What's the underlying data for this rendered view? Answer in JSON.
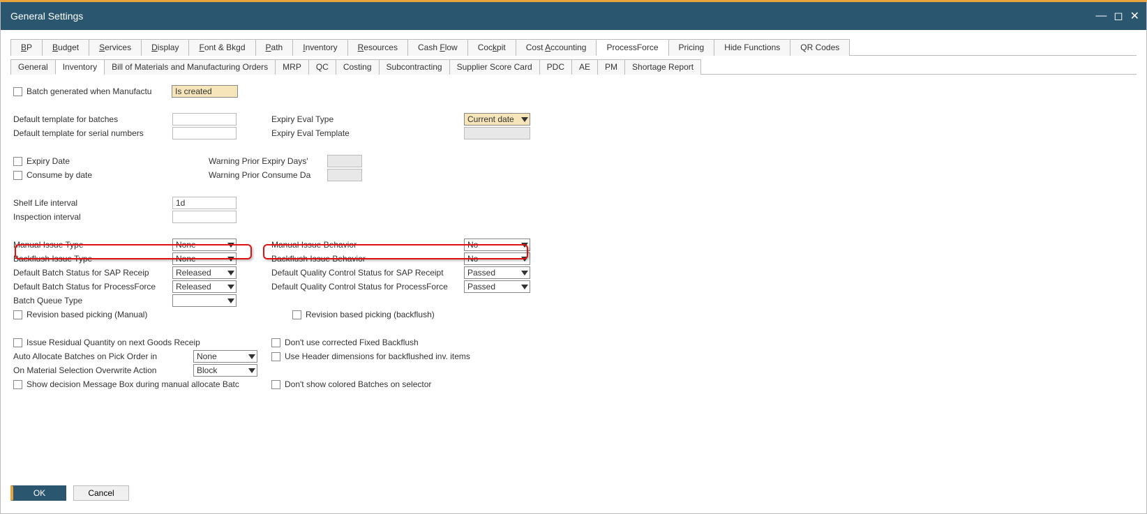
{
  "window": {
    "title": "General Settings"
  },
  "mainTabs": [
    {
      "label": "BP",
      "ul": "B",
      "rest": "P"
    },
    {
      "label": "Budget",
      "ul": "B",
      "rest": "udget"
    },
    {
      "label": "Services",
      "ul": "S",
      "rest": "ervices"
    },
    {
      "label": "Display",
      "ul": "D",
      "rest": "isplay"
    },
    {
      "label": "Font & Bkgd",
      "ul": "F",
      "rest": "ont & Bkgd"
    },
    {
      "label": "Path",
      "ul": "P",
      "rest": "ath"
    },
    {
      "label": "Inventory",
      "ul": "I",
      "rest": "nventory"
    },
    {
      "label": "Resources",
      "ul": "R",
      "rest": "esources"
    },
    {
      "label": "Cash Flow",
      "pre": "Cash ",
      "ul": "F",
      "rest": "low"
    },
    {
      "label": "Cockpit",
      "pre": "Coc",
      "ul": "k",
      "rest": "pit"
    },
    {
      "label": "Cost Accounting",
      "pre": "Cost ",
      "ul": "A",
      "rest": "ccounting"
    },
    {
      "label": "ProcessForce"
    },
    {
      "label": "Pricing"
    },
    {
      "label": "Hide Functions"
    },
    {
      "label": "QR Codes"
    }
  ],
  "subTabs": [
    "General",
    "Inventory",
    "Bill of Materials and Manufacturing Orders",
    "MRP",
    "QC",
    "Costing",
    "Subcontracting",
    "Supplier Score Card",
    "PDC",
    "AE",
    "PM",
    "Shortage Report"
  ],
  "labels": {
    "batchGenerated": "Batch generated when Manufactu",
    "isCreated": "Is created",
    "defaultTemplateBatches": "Default template for batches",
    "defaultTemplateSerial": "Default template for serial numbers",
    "expiryEvalType": "Expiry Eval Type",
    "expiryEvalTemplate": "Expiry Eval Template",
    "expiryDate": "Expiry Date",
    "consumeByDate": "Consume by date",
    "warningPriorExpiry": "Warning Prior Expiry Days'",
    "warningPriorConsume": "Warning Prior Consume Da",
    "shelfLifeInterval": "Shelf Life interval",
    "inspectionInterval": "Inspection interval",
    "manualIssueType": "Manual Issue Type",
    "manualIssueBehavior": "Manual Issue Behavior",
    "backflushIssueType": "Backflush Issue Type",
    "backflushIssueBehavior": "Backflush Issue Behavior",
    "defaultBatchSAP": "Default Batch Status for SAP Receip",
    "defaultQCSAP": "Default Quality Control Status for SAP Receipt",
    "defaultBatchPF": "Default Batch Status for ProcessForce",
    "defaultQCPF": "Default Quality Control Status for ProcessForce",
    "batchQueueType": "Batch Queue Type",
    "revisionManual": "Revision based picking (Manual)",
    "revisionBackflush": "Revision based picking (backflush)",
    "issueResidual": "Issue Residual Quantity on next Goods Receip",
    "autoAllocate": "Auto Allocate Batches on Pick Order in",
    "onMaterialSelection": "On Material Selection Overwrite Action",
    "showDecisionMsg": "Show decision Message Box during manual allocate Batc",
    "dontUseCorrected": "Don't use corrected Fixed Backflush",
    "useHeaderDim": "Use Header dimensions for backflushed inv. items",
    "dontShowColored": "Don't show colored Batches on selector"
  },
  "values": {
    "currentDate": "Current date",
    "shelfLife": "1d",
    "none": "None",
    "no": "No",
    "released": "Released",
    "passed": "Passed",
    "block": "Block"
  },
  "buttons": {
    "ok": "OK",
    "cancel": "Cancel"
  }
}
